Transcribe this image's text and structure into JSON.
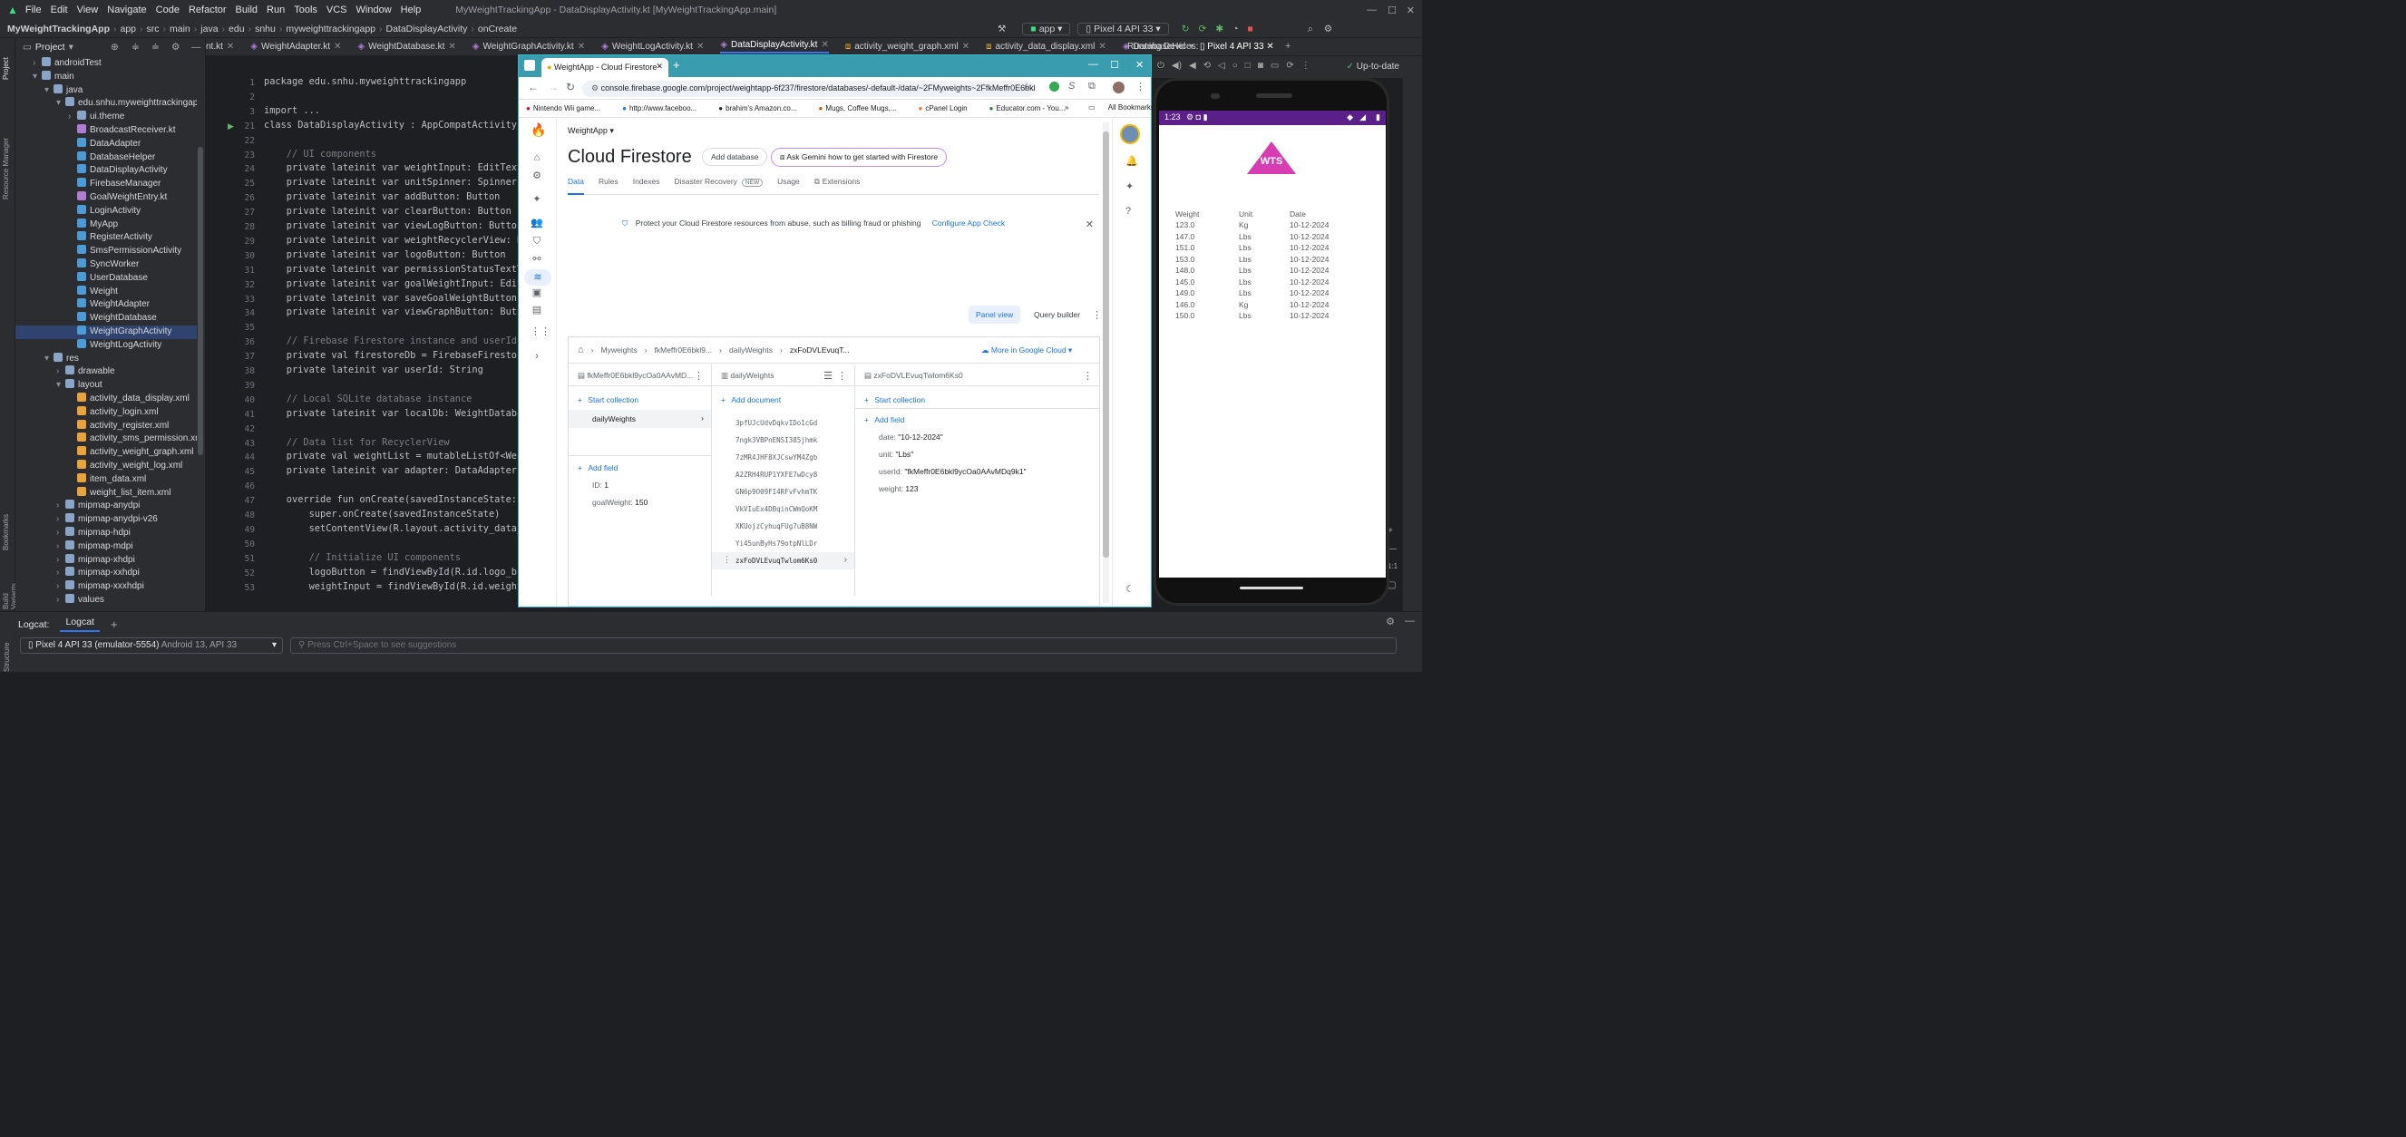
{
  "ide": {
    "menu": [
      "File",
      "Edit",
      "View",
      "Navigate",
      "Code",
      "Refactor",
      "Build",
      "Run",
      "Tools",
      "VCS",
      "Window",
      "Help"
    ],
    "window_title": "MyWeightTrackingApp - DataDisplayActivity.kt [MyWeightTrackingApp.main]",
    "breadcrumb": [
      "MyWeightTrackingApp",
      "app",
      "src",
      "main",
      "java",
      "edu",
      "snhu",
      "myweighttrackingapp",
      "DataDisplayActivity",
      "onCreate"
    ],
    "run_config": "app",
    "device": "Pixel 4 API 33",
    "project_label": "Project",
    "tabs": [
      "nt.kt",
      "WeightAdapter.kt",
      "WeightDatabase.kt",
      "WeightGraphActivity.kt",
      "WeightLogActivity.kt",
      "DataDisplayActivity.kt",
      "activity_weight_graph.xml",
      "activity_data_display.xml",
      "DatabaseHel"
    ],
    "active_tab": "DataDisplayActivity.kt",
    "running_devices_label": "Running Devices:",
    "running_device": "Pixel 4 API 33",
    "tree": [
      {
        "label": "androidTest",
        "level": 1,
        "kind": "folder"
      },
      {
        "label": "main",
        "level": 1,
        "kind": "folder"
      },
      {
        "label": "java",
        "level": 2,
        "kind": "folder"
      },
      {
        "label": "edu.snhu.myweighttrackingapp",
        "level": 3,
        "kind": "folder"
      },
      {
        "label": "ui.theme",
        "level": 4,
        "kind": "folder"
      },
      {
        "label": "BroadcastReceiver.kt",
        "level": 4,
        "kind": "file"
      },
      {
        "label": "DataAdapter",
        "level": 4,
        "kind": "class"
      },
      {
        "label": "DatabaseHelper",
        "level": 4,
        "kind": "class"
      },
      {
        "label": "DataDisplayActivity",
        "level": 4,
        "kind": "class"
      },
      {
        "label": "FirebaseManager",
        "level": 4,
        "kind": "class"
      },
      {
        "label": "GoalWeightEntry.kt",
        "level": 4,
        "kind": "file"
      },
      {
        "label": "LoginActivity",
        "level": 4,
        "kind": "class"
      },
      {
        "label": "MyApp",
        "level": 4,
        "kind": "class"
      },
      {
        "label": "RegisterActivity",
        "level": 4,
        "kind": "class"
      },
      {
        "label": "SmsPermissionActivity",
        "level": 4,
        "kind": "class"
      },
      {
        "label": "SyncWorker",
        "level": 4,
        "kind": "class"
      },
      {
        "label": "UserDatabase",
        "level": 4,
        "kind": "class"
      },
      {
        "label": "Weight",
        "level": 4,
        "kind": "class"
      },
      {
        "label": "WeightAdapter",
        "level": 4,
        "kind": "class"
      },
      {
        "label": "WeightDatabase",
        "level": 4,
        "kind": "class"
      },
      {
        "label": "WeightGraphActivity",
        "level": 4,
        "kind": "class",
        "selected": true
      },
      {
        "label": "WeightLogActivity",
        "level": 4,
        "kind": "class"
      },
      {
        "label": "res",
        "level": 2,
        "kind": "folder"
      },
      {
        "label": "drawable",
        "level": 3,
        "kind": "folder"
      },
      {
        "label": "layout",
        "level": 3,
        "kind": "folder"
      },
      {
        "label": "activity_data_display.xml",
        "level": 4,
        "kind": "xml"
      },
      {
        "label": "activity_login.xml",
        "level": 4,
        "kind": "xml"
      },
      {
        "label": "activity_register.xml",
        "level": 4,
        "kind": "xml"
      },
      {
        "label": "activity_sms_permission.xml",
        "level": 4,
        "kind": "xml"
      },
      {
        "label": "activity_weight_graph.xml",
        "level": 4,
        "kind": "xml"
      },
      {
        "label": "activity_weight_log.xml",
        "level": 4,
        "kind": "xml"
      },
      {
        "label": "item_data.xml",
        "level": 4,
        "kind": "xml"
      },
      {
        "label": "weight_list_item.xml",
        "level": 4,
        "kind": "xml"
      },
      {
        "label": "mipmap-anydpi",
        "level": 3,
        "kind": "folder"
      },
      {
        "label": "mipmap-anydpi-v26",
        "level": 3,
        "kind": "folder"
      },
      {
        "label": "mipmap-hdpi",
        "level": 3,
        "kind": "folder"
      },
      {
        "label": "mipmap-mdpi",
        "level": 3,
        "kind": "folder"
      },
      {
        "label": "mipmap-xhdpi",
        "level": 3,
        "kind": "folder"
      },
      {
        "label": "mipmap-xxhdpi",
        "level": 3,
        "kind": "folder"
      },
      {
        "label": "mipmap-xxxhdpi",
        "level": 3,
        "kind": "folder"
      },
      {
        "label": "values",
        "level": 3,
        "kind": "folder"
      }
    ],
    "line_numbers": [
      "1",
      "2",
      "3",
      "21",
      "22",
      "23",
      "24",
      "25",
      "26",
      "27",
      "28",
      "29",
      "30",
      "31",
      "32",
      "33",
      "34",
      "35",
      "36",
      "37",
      "38",
      "39",
      "40",
      "41",
      "42",
      "43",
      "44",
      "45",
      "46",
      "47",
      "48",
      "49",
      "50",
      "51",
      "52",
      "53"
    ],
    "code_lines": [
      "package edu.snhu.myweighttrackingapp",
      "",
      "import ...",
      "class DataDisplayActivity : AppCompatActivity() {",
      "",
      "    // UI components",
      "    private lateinit var weightInput: EditText",
      "    private lateinit var unitSpinner: Spinner",
      "    private lateinit var addButton: Button",
      "    private lateinit var clearButton: Button",
      "    private lateinit var viewLogButton: Button",
      "    private lateinit var weightRecyclerView: Rec",
      "    private lateinit var logoButton: Button",
      "    private lateinit var permissionStatusTextVie",
      "    private lateinit var goalWeightInput: EditTe",
      "    private lateinit var saveGoalWeightButton: B",
      "    private lateinit var viewGraphButton: Button",
      "",
      "    // Firebase Firestore instance and userId i",
      "    private val firestoreDb = FirebaseFirestore",
      "    private lateinit var userId: String",
      "",
      "    // Local SQLite database instance",
      "    private lateinit var localDb: WeightDatabase",
      "",
      "    // Data list for RecyclerView",
      "    private val weightList = mutableListOf<Weigh",
      "    private lateinit var adapter: DataAdapter",
      "",
      "    override fun onCreate(savedInstanceState: Bu",
      "        super.onCreate(savedInstanceState)",
      "        setContentView(R.layout.activity_data_di",
      "",
      "        // Initialize UI components",
      "        logoButton = findViewById(R.id.logo_butt",
      "        weightInput = findViewById(R.id.weight_i"
    ],
    "logcat_tabs": [
      "Logcat:",
      "Logcat"
    ],
    "logcat_device": "Pixel 4 API 33 (emulator-5554)",
    "logcat_device_detail": "Android 13, API 33",
    "logcat_filter_placeholder": "Press Ctrl+Space to see suggestions",
    "left_strip_labels": [
      "Project",
      "Resource Manager",
      "Bookmarks",
      "Build Variants",
      "Structure"
    ]
  },
  "browser": {
    "tab_title": "WeightApp - Cloud Firestore",
    "url": "console.firebase.google.com/project/weightapp-6f237/firestore/databases/-default-/data/~2FMyweights~2FfkMeffr0E6bkl...",
    "bookmarks": [
      "Nintendo Wii game...",
      "http://www.faceboo...",
      "brahim's Amazon.co...",
      "Mugs, Coffee Mugs,...",
      "cPanel Login",
      "Educator.com - You..."
    ],
    "all_bookmarks": "All Bookmarks",
    "project_name": "WeightApp",
    "page_title": "Cloud Firestore",
    "add_database": "Add database",
    "gemini_btn": "Ask Gemini how to get started with Firestore",
    "subtabs": [
      "Data",
      "Rules",
      "Indexes",
      "Disaster Recovery",
      "Usage",
      "Extensions"
    ],
    "new_badge": "NEW",
    "banner_text": "Protect your Cloud Firestore resources from abuse, such as billing fraud or phishing",
    "banner_link": "Configure App Check",
    "panel_view": "Panel view",
    "query_builder": "Query builder",
    "path": [
      "Myweights",
      "fkMeffr0E6bkl9...",
      "dailyWeights",
      "zxFoDVLEvuqT..."
    ],
    "more_in_cloud": "More in Google Cloud",
    "col1": {
      "header": "fkMeffr0E6bkl9ycOa0AAvMD...",
      "start_collection": "Start collection",
      "items": [
        "dailyWeights"
      ],
      "add_field": "Add field",
      "fields": [
        {
          "key": "ID",
          "value": "1"
        },
        {
          "key": "goalWeight",
          "value": "150"
        }
      ]
    },
    "col2": {
      "header": "dailyWeights",
      "add_document": "Add document",
      "docs": [
        "3pfUJcUdvDqkvIDo1cGd",
        "7ngk3VBPnENSI385jhmk",
        "7zMR4JHF8XJCswYM4Zgb",
        "A2ZRH4RUP1YXFE7wDcy8",
        "GN6p9O09FI4RFvFvhmTK",
        "VkVIuEx4DBqinCWmQoKM",
        "XKUojzCyhuqFUg7uB8NW",
        "Yi45unByHs79otpNlLDr",
        "zxFoDVLEvuqTwlom6Ks0"
      ],
      "selected": "zxFoDVLEvuqTwlom6Ks0"
    },
    "col3": {
      "header": "zxFoDVLEvuqTwlom6Ks0",
      "start_collection": "Start collection",
      "add_field": "Add field",
      "fields": [
        {
          "key": "date",
          "value": "\"10-12-2024\""
        },
        {
          "key": "unit",
          "value": "\"Lbs\""
        },
        {
          "key": "userId",
          "value": "\"fkMeffr0E6bkl9ycOa0AAvMDq9k1\""
        },
        {
          "key": "weight",
          "value": "123"
        }
      ]
    }
  },
  "phone": {
    "time": "1:23",
    "logo": "WTS",
    "headers": [
      "Weight",
      "Unit",
      "Date"
    ],
    "rows": [
      [
        "123.0",
        "Kg",
        "10-12-2024"
      ],
      [
        "147.0",
        "Lbs",
        "10-12-2024"
      ],
      [
        "151.0",
        "Lbs",
        "10-12-2024"
      ],
      [
        "153.0",
        "Lbs",
        "10-12-2024"
      ],
      [
        "148.0",
        "Lbs",
        "10-12-2024"
      ],
      [
        "145.0",
        "Lbs",
        "10-12-2024"
      ],
      [
        "149.0",
        "Lbs",
        "10-12-2024"
      ],
      [
        "146.0",
        "Kg",
        "10-12-2024"
      ],
      [
        "150.0",
        "Lbs",
        "10-12-2024"
      ]
    ],
    "zoom_label": "1:1",
    "up_to_date": "Up-to-date"
  }
}
